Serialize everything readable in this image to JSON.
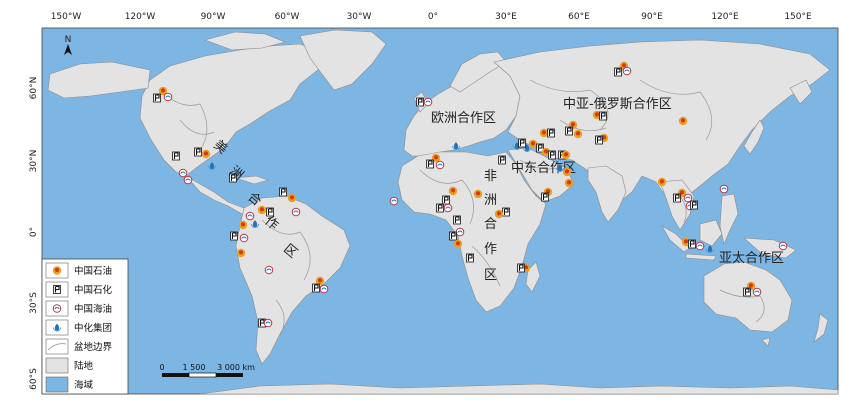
{
  "colors": {
    "ocean": "#7db6e3",
    "land": "#e3e3e3",
    "basin_line": "#9a9a9a",
    "cnpc": "#e9a020",
    "sinopec": "#111111",
    "cnooc": "#b23a48",
    "sinochem": "#2a6fb5"
  },
  "axis": {
    "top_ticks": [
      "150°W",
      "120°W",
      "90°W",
      "60°W",
      "30°W",
      "0°",
      "30°E",
      "60°E",
      "90°E",
      "120°E",
      "150°E"
    ],
    "left_ticks": [
      "60°N",
      "30°N",
      "0°",
      "30°S",
      "60°S"
    ]
  },
  "north_arrow": "N",
  "regions": {
    "europe": "欧洲合作区",
    "central_asia_russia": "中亚-俄罗斯合作区",
    "middle_east": "中东合作区",
    "africa_chars": [
      "非",
      "洲",
      "合",
      "作",
      "区"
    ],
    "americas_chars": [
      "美",
      "洲",
      "合",
      "作",
      "区"
    ],
    "asia_pacific": "亚太合作区"
  },
  "scale_bar": {
    "labels": [
      "0",
      "1 500",
      "3 000 km"
    ]
  },
  "legend": {
    "items": [
      {
        "label": "中国石油",
        "icon": "cnpc-icon"
      },
      {
        "label": "中国石化",
        "icon": "sinopec-icon"
      },
      {
        "label": "中国海油",
        "icon": "cnooc-icon"
      },
      {
        "label": "中化集团",
        "icon": "sinochem-icon"
      },
      {
        "label": "盆地边界",
        "icon": "basin-boundary-icon"
      },
      {
        "label": "陆地",
        "icon": "land-swatch-icon"
      },
      {
        "label": "海域",
        "icon": "ocean-swatch-icon"
      }
    ]
  }
}
